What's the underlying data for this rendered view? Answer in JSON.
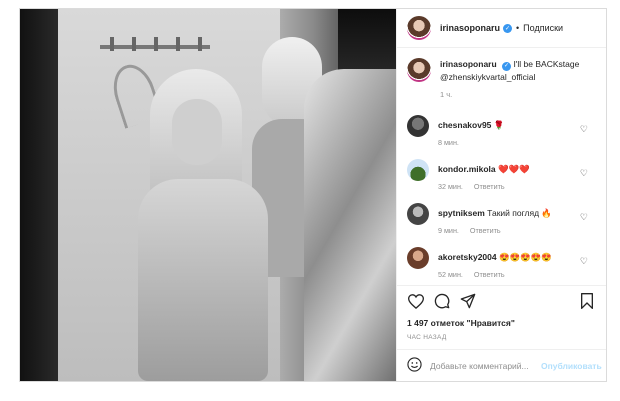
{
  "post": {
    "author": "irinasoponaru",
    "follow_label": "Подписки",
    "dot": "•"
  },
  "caption": {
    "author": "irinasoponaru",
    "text": "I'll be BACKstage",
    "mention": "@zhenskiykvartal_official",
    "time": "1 ч."
  },
  "comments": [
    {
      "user": "chesnakov95",
      "text": "🌹",
      "time": "8 мин.",
      "reply": ""
    },
    {
      "user": "kondor.mikola",
      "text": "❤️❤️❤️",
      "time": "32 мин.",
      "reply": "Ответить"
    },
    {
      "user": "spytniksem",
      "text": "Такий погляд 🔥",
      "time": "9 мин.",
      "reply": "Ответить"
    },
    {
      "user": "akoretsky2004",
      "text": "😍😍😍😍😍",
      "time": "52 мин.",
      "reply": "Ответить"
    }
  ],
  "actions": {
    "likes": "1 497 отметок \"Нравится\"",
    "time": "ЧАС НАЗАД"
  },
  "add_comment": {
    "placeholder": "Добавьте комментарий...",
    "publish": "Опубликовать"
  },
  "icons": [
    "verified-badge",
    "heart-icon",
    "comment-icon",
    "share-icon",
    "bookmark-icon",
    "emoji-icon"
  ]
}
